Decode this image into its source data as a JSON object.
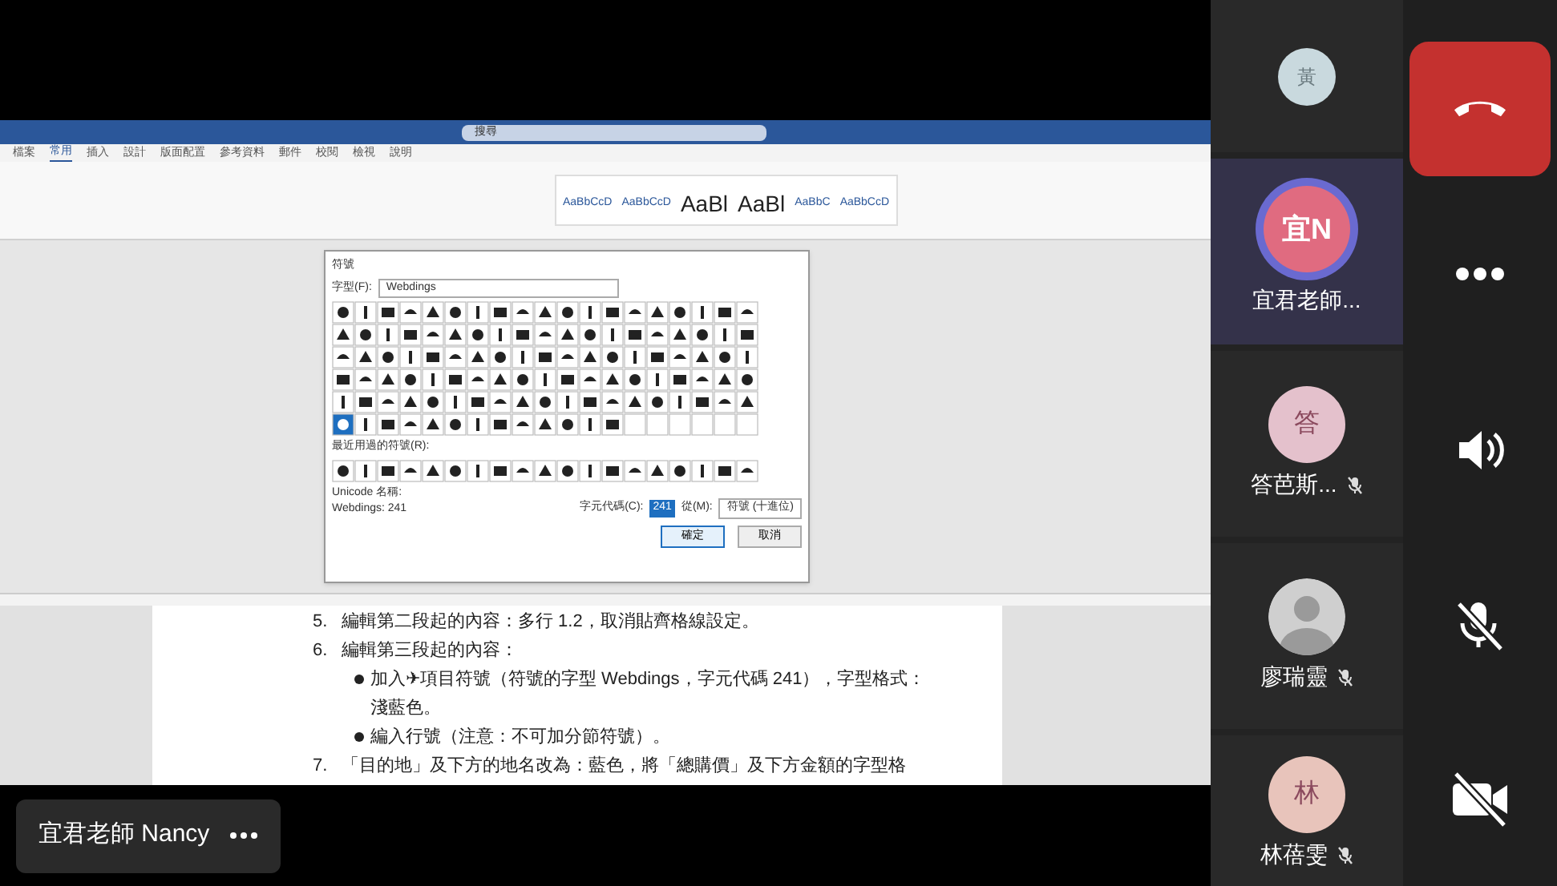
{
  "shared_screen": {
    "word": {
      "search": "搜尋",
      "tabs": [
        {
          "label": "檔案",
          "selected": false
        },
        {
          "label": "常用",
          "selected": true
        },
        {
          "label": "插入",
          "selected": false
        },
        {
          "label": "設計",
          "selected": false
        },
        {
          "label": "版面配置",
          "selected": false
        },
        {
          "label": "參考資料",
          "selected": false
        },
        {
          "label": "郵件",
          "selected": false
        },
        {
          "label": "校閱",
          "selected": false
        },
        {
          "label": "檢視",
          "selected": false
        },
        {
          "label": "說明",
          "selected": false
        }
      ],
      "styles": [
        "AaBbCcD",
        "AaBbCcD",
        "AaBl",
        "AaBl",
        "AaBbC",
        "AaBbCcD"
      ],
      "dialog": {
        "title": "符號",
        "font_label": "字型(F):",
        "font_value": "Webdings",
        "recent_label": "最近用過的符號(R):",
        "unicode_name": "Unicode 名稱:",
        "char_info": "Webdings: 241",
        "code_label": "字元代碼(C):",
        "code_value": "241",
        "from_label": "從(M):",
        "from_value": "符號 (十進位)",
        "buttons": [
          "確定",
          "取消"
        ]
      },
      "document_lines": [
        {
          "kind": "numbered",
          "marker": "5.",
          "text": "編輯第二段起的內容：多行 1.2，取消貼齊格線設定。"
        },
        {
          "kind": "numbered",
          "marker": "6.",
          "text": "編輯第三段起的內容："
        },
        {
          "kind": "bullet",
          "text": "加入✈項目符號（符號的字型 Webdings，字元代碼 241），字型格式："
        },
        {
          "kind": "continuation",
          "text": "淺藍色。"
        },
        {
          "kind": "bullet",
          "text": "編入行號（注意：不可加分節符號）。"
        },
        {
          "kind": "numbered",
          "marker": "7.",
          "text": "「目的地」及下方的地名改為：藍色，將「總購價」及下方金額的字型格"
        }
      ]
    },
    "presenter": "宜君老師 Nancy"
  },
  "participants": [
    {
      "initial": "黃",
      "kind": "initial",
      "color": "#c9d9de",
      "selected": false
    },
    {
      "initial": "宜N",
      "name": "宜君老師...",
      "kind": "initial",
      "color": "#e06b80",
      "selected": true,
      "muted": false
    },
    {
      "initial": "答",
      "name": "答芭斯...",
      "kind": "initial",
      "color": "#e4c1cc",
      "selected": false,
      "muted": true
    },
    {
      "name": "廖瑞靈",
      "kind": "silhouette",
      "color": "#cfcfcf",
      "selected": false,
      "muted": true
    },
    {
      "initial": "林",
      "name": "林蓓雯",
      "kind": "initial",
      "color": "#e8c4bb",
      "selected": false,
      "muted": true
    }
  ],
  "controls": [
    {
      "kind": "hangup"
    },
    {
      "kind": "more"
    },
    {
      "kind": "speaker"
    },
    {
      "kind": "mic_off"
    },
    {
      "kind": "camera_off"
    }
  ]
}
